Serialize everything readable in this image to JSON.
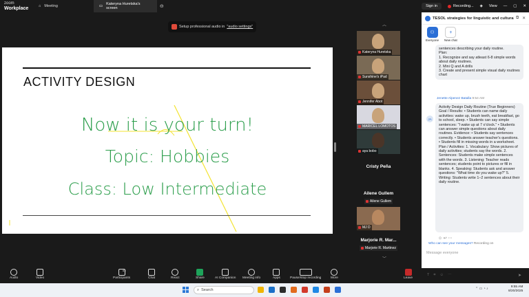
{
  "topbar": {
    "brand_line1": "zoom",
    "brand_line2": "Workplace",
    "tabs": [
      {
        "label": "Meeting"
      },
      {
        "label": "Kateryna Huretska's screen"
      }
    ],
    "sign_in": "Sign in",
    "recording": "Recording...",
    "view": "View"
  },
  "notice": {
    "text": "Setup professional audio in",
    "link": "\"audio settings\""
  },
  "slide": {
    "title": "ACTIVITY DESIGN",
    "line1": "Now it is your turn!",
    "line2": "Topic: Hobbies",
    "line3": "Class: Low Intermediate",
    "ink_color": "#2a9d4a"
  },
  "gallery": {
    "tiles": [
      {
        "name": "Kateryna Huretska"
      },
      {
        "name": "Sunshine's iPad"
      },
      {
        "name": "Jennifer Abot"
      },
      {
        "name": "MARICEL LOMOTOS"
      },
      {
        "name": "aya bobo"
      }
    ],
    "names": [
      {
        "big": "Cristy Peña",
        "small": ""
      },
      {
        "big": "Ailene Gullem",
        "small": "Ailene Gullem"
      },
      {
        "big": "",
        "small": "MJ D"
      },
      {
        "big": "Marjorie R. Mar...",
        "small": "Marjorie R. Martinez"
      }
    ]
  },
  "chat": {
    "title": "TESOL strategies for linguistic and cultural...",
    "chip_everyone": "Everyone",
    "chip_new": "New chat",
    "msg1": "sentences describing your daily routine.\nPlan:\n1. Recognize and say atleast 6-8 simple words about daily routines.\n2. Mini Q and A drills\n3. Create and present simple visual daily routines chart",
    "sender_name": "Jenette Alpenez Batalla",
    "sender_time": "9:54 AM",
    "avatar_initials": "JA",
    "msg2": "Activity Design Daily Routine (True Beginners) Goal / Results: • Students can name daily activities: wake up, brush teeth, eat breakfast, go to school, sleep. • Students can say simple sentences: \"I wake up at 7 o'clock.\" • Students can answer simple questions about daily routines. Evidence: • Students say sentences correctly. • Students answer teacher's questions. • Students fill in missing words in a worksheet. Plan / Activities: 1. Vocabulary: Show pictures of daily activities; students say the words. 2. Sentences: Students make simple sentences with the words. 3. Listening: Teacher reads sentences; students point to pictures or fill in blanks. 4. Speaking: Students ask and answer questions: \"What time do you wake up?\" 5. Writing: Students write 1–2 sentences about their daily routine.",
    "who_prefix": "Who can see your messages?",
    "who_suffix": "Recording on",
    "input_placeholder": "Message everyone"
  },
  "toolbar": {
    "audio": "Audio",
    "video": "Video",
    "participants": "Participants",
    "participants_count": "83",
    "chat": "Chat",
    "react": "React",
    "share": "Share",
    "ai": "AI Companion",
    "info": "Meeting info",
    "apps": "Apps",
    "pause": "Pause/stop recording",
    "more": "More",
    "leave": "Leave"
  },
  "taskbar": {
    "search": "Search",
    "time": "9:55 AM",
    "date": "8/20/2025"
  },
  "colors": {
    "accent": "#2b6fd6",
    "green_ink": "#2a9d4a",
    "recording": "#e02828"
  }
}
